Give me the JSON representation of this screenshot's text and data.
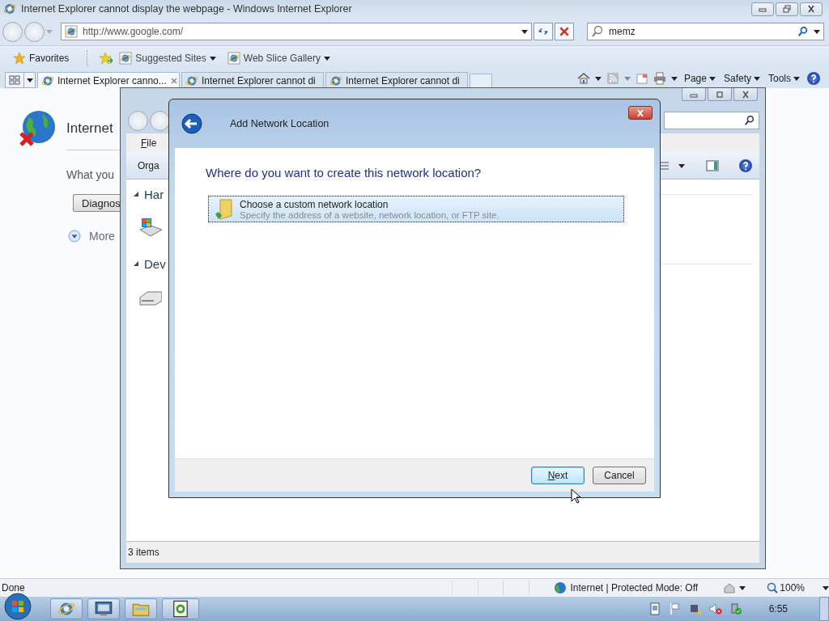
{
  "browser": {
    "title": "Internet Explorer cannot display the webpage - Windows Internet Explorer",
    "address": "http://www.google.com/",
    "search": "memz",
    "favorites": "Favorites",
    "links": [
      {
        "label": "Suggested Sites"
      },
      {
        "label": "Web Slice Gallery"
      }
    ],
    "tabs": [
      {
        "label": "Internet Explorer canno...",
        "selected": true
      },
      {
        "label": "Internet Explorer cannot di",
        "selected": false
      },
      {
        "label": "Internet Explorer cannot di",
        "selected": false
      }
    ],
    "commands": [
      "Page",
      "Safety",
      "Tools"
    ],
    "page": {
      "heading": "Internet",
      "text": "What you",
      "button": "Diagnos",
      "more": "More"
    },
    "status": {
      "text": "Done",
      "zone": "Internet | Protected Mode: Off",
      "zoom": "100%"
    }
  },
  "explorer": {
    "menu": [
      "File"
    ],
    "toolbar": "Orga",
    "groups": [
      {
        "label": "Har",
        "expanded": true,
        "kind": "hardware"
      },
      {
        "label": "Dev",
        "expanded": true,
        "kind": "drive"
      }
    ],
    "status": "3 items"
  },
  "dialog": {
    "title": "Add Network Location",
    "question": "Where do you want to create this network location?",
    "options": [
      {
        "title": "Choose a custom network location",
        "description": "Specify the address of a website, network location, or FTP site.",
        "selected": true
      }
    ],
    "buttons": [
      {
        "label": "Next",
        "default": true
      },
      {
        "label": "Cancel",
        "default": false
      }
    ]
  },
  "taskbar": {
    "clock": "6:55"
  }
}
